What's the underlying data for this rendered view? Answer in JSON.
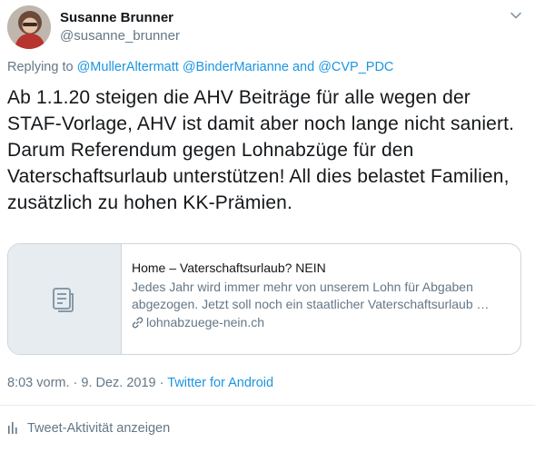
{
  "author": {
    "name": "Susanne Brunner",
    "handle": "@susanne_brunner"
  },
  "icons": {
    "caret": "chevron-down-icon",
    "card": "document-icon",
    "link": "link-icon",
    "activity": "bar-chart-icon"
  },
  "replying": {
    "prefix": "Replying to",
    "mention1": "@MullerAltermatt",
    "mention2": "@BinderMarianne",
    "and": "and",
    "mention3": "@CVP_PDC"
  },
  "tweet": {
    "text": "Ab 1.1.20 steigen die AHV Beiträge für alle wegen der STAF-Vorlage, AHV ist damit aber noch lange nicht saniert. Darum Referendum gegen Lohnabzüge für den Vaterschaftsurlaub unterstützen! All dies belastet Familien, zusätzlich zu hohen KK-Prämien."
  },
  "card": {
    "title": "Home – Vaterschaftsurlaub? NEIN",
    "description": "Jedes Jahr wird immer mehr von unserem Lohn für Abgaben abgezogen. Jetzt soll noch ein staatlicher Vaterschaftsurlaub …",
    "domain": "lohnabzuege-nein.ch"
  },
  "meta": {
    "timestamp": "8:03 vorm. · 9. Dez. 2019",
    "separator": " · ",
    "source": "Twitter for Android"
  },
  "activity": {
    "label": "Tweet-Aktivität anzeigen"
  },
  "colors": {
    "link": "#1b95e0",
    "secondary": "#657786",
    "text": "#14171a",
    "border": "#ccd6dd"
  }
}
